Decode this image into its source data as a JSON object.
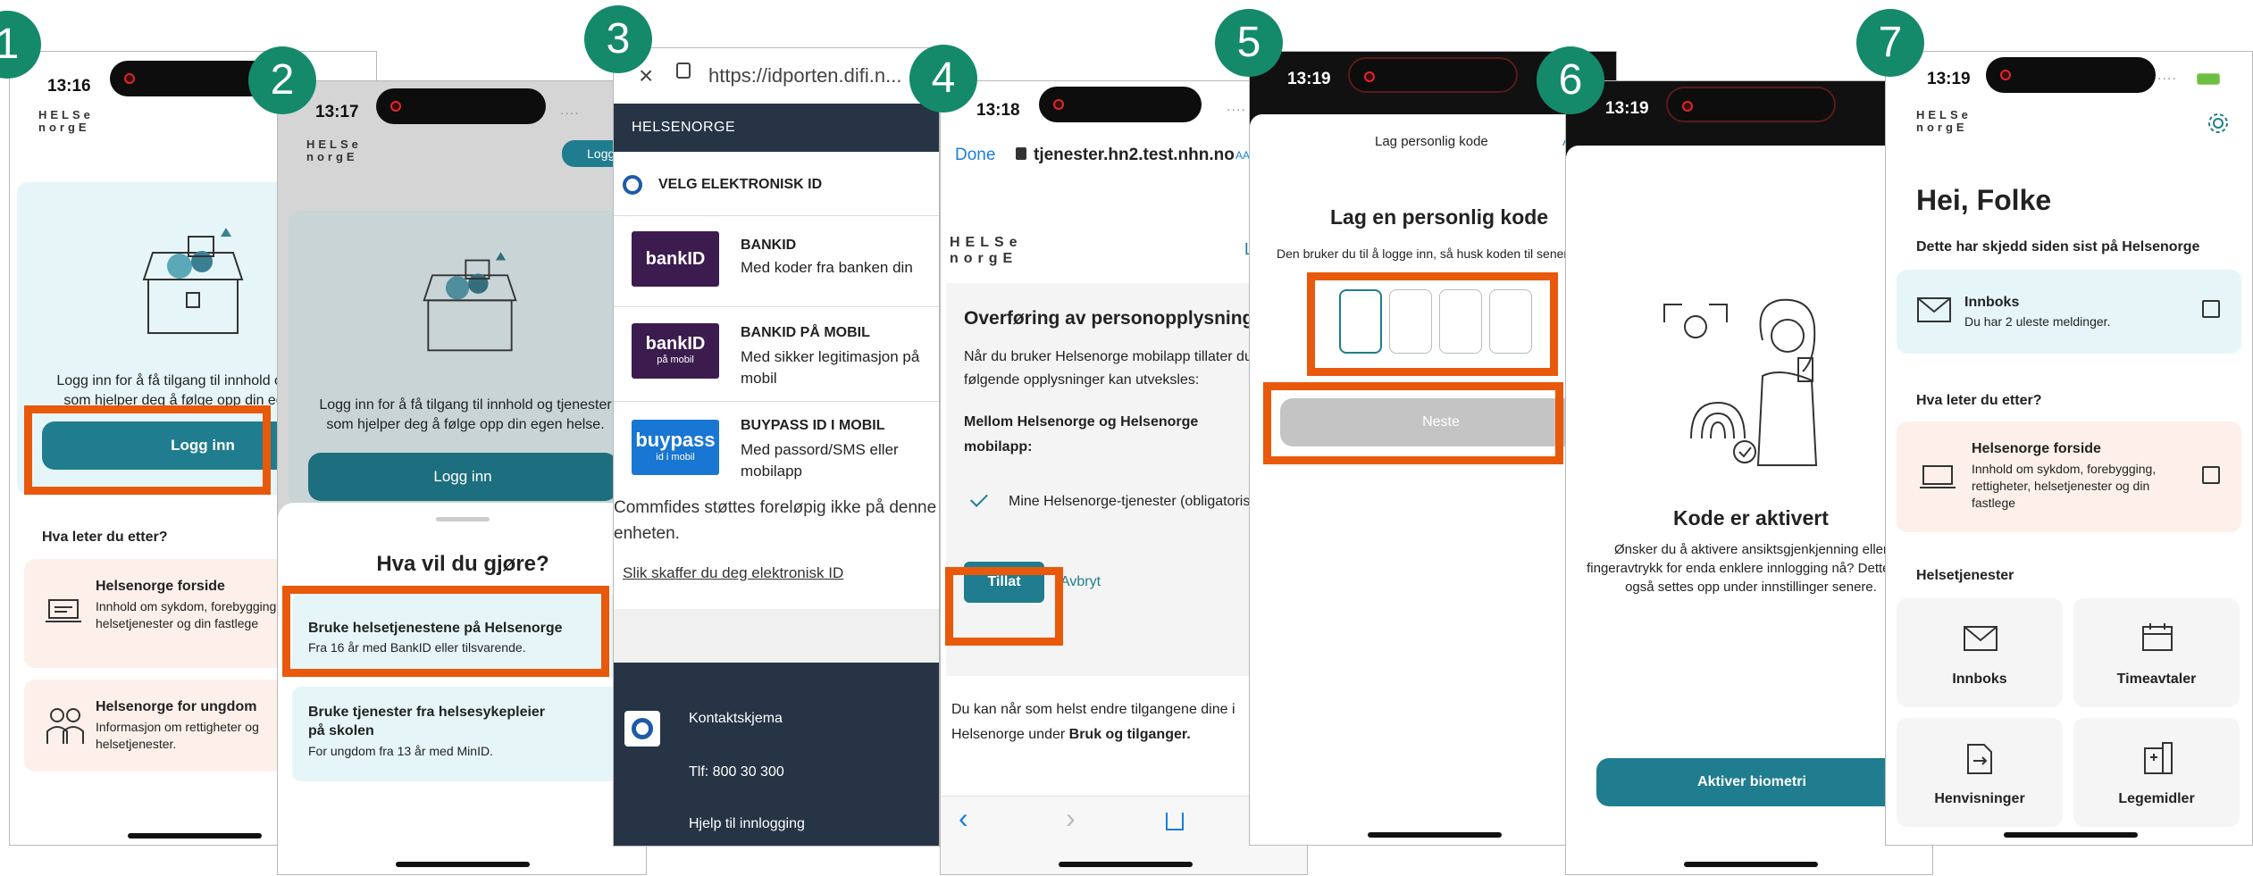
{
  "badges": [
    "1",
    "2",
    "3",
    "4",
    "5",
    "6",
    "7"
  ],
  "logo": {
    "line1": "HELSe",
    "line2": "norgE"
  },
  "colors": {
    "teal": "#1f7d8f",
    "badge": "#158a6b",
    "highlight": "#e8590c",
    "peach": "#fdf0ea",
    "lightblue": "#e6f6f8",
    "navy": "#263445"
  },
  "s1": {
    "time": "13:16",
    "intro": "Logg inn for å få tilgang til innhold og tjenester som hjelper deg å følge opp din egen helse.",
    "login": "Logg inn",
    "section": "Hva leter du etter?",
    "card1_title": "Helsenorge forside",
    "card1_desc": "Innhold om sykdom, forebygging, rettigheter, helsetjenester og din fastlege",
    "card2_title": "Helsenorge for ungdom",
    "card2_desc": "Informasjon om rettigheter og helsetjenester."
  },
  "s2": {
    "time": "13:17",
    "login_small": "Logg inn",
    "intro": "Logg inn for å få tilgang til innhold og tjenester som hjelper deg å følge opp din egen helse.",
    "login": "Logg inn",
    "sheet_title": "Hva vil du gjøre?",
    "opt1_title": "Bruke helsetjenestene på Helsenorge",
    "opt1_desc": "Fra 16 år med BankID eller tilsvarende.",
    "opt2_title": "Bruke tjenester fra helsesykepleier på skolen",
    "opt2_desc": "For ungdom fra 13 år med MinID."
  },
  "s3": {
    "url": "https://idporten.difi.n...",
    "header": "HELSENORGE",
    "choose": "VELG ELEKTRONISK ID",
    "id1_title": "BANKID",
    "id1_desc": "Med koder fra banken din",
    "id2_title": "BANKID PÅ MOBIL",
    "id2_desc": "Med sikker legitimasjon på mobil",
    "id3_title": "BUYPASS ID I MOBIL",
    "id3_desc": "Med passord/SMS eller mobilapp",
    "bankid_logo": "bankID",
    "bankid_mobil_logo": "bankID",
    "bankid_mobil_sub": "på mobil",
    "buypass_logo": "buypass",
    "buypass_sub": "id i mobil",
    "note": "Commfides støttes foreløpig ikke på denne enheten.",
    "link": "Slik skaffer du deg elektronisk ID",
    "footer1": "Kontaktskjema",
    "footer2": "Tlf: 800 30 300",
    "footer3": "Hjelp til innlogging"
  },
  "s4": {
    "time": "13:18",
    "done": "Done",
    "url": "tjenester.hn2.test.nhn.no",
    "aa": "AA",
    "title": "Overføring av personopplysninger",
    "p1": "Når du bruker Helsenorge mobilapp tillater du at følgende opplysninger kan utveksles:",
    "sub": "Mellom Helsenorge og Helsenorge mobilapp:",
    "check_item": "Mine Helsenorge-tjenester (obligatorisk)",
    "allow": "Tillat",
    "cancel": "Avbryt",
    "p2_a": "Du kan når som helst endre tilgangene dine i Helsenorge under ",
    "p2_b": "Bruk og tilganger."
  },
  "s5": {
    "time": "13:19",
    "nav_title": "Lag personlig kode",
    "title": "Lag en personlig kode",
    "desc": "Den bruker du til å logge inn, så husk koden til senere.",
    "next": "Neste"
  },
  "s6": {
    "time": "13:19",
    "title": "Kode er aktivert",
    "desc": "Ønsker du å aktivere ansiktsgjenkjenning eller fingeravtrykk for enda enklere innlogging nå? Dette kan også settes opp under innstillinger senere.",
    "btn": "Aktiver biometri"
  },
  "s7": {
    "time": "13:19",
    "greeting": "Hei, Folke",
    "since": "Dette har skjedd siden sist på Helsenorge",
    "inbox_title": "Innboks",
    "inbox_desc": "Du har 2 uleste meldinger.",
    "section": "Hva leter du etter?",
    "front_title": "Helsenorge forside",
    "front_desc": "Innhold om sykdom, forebygging, rettigheter, helsetjenester og din fastlege",
    "services": "Helsetjenester",
    "tiles": [
      "Innboks",
      "Timeavtaler",
      "Henvisninger",
      "Legemidler"
    ]
  }
}
